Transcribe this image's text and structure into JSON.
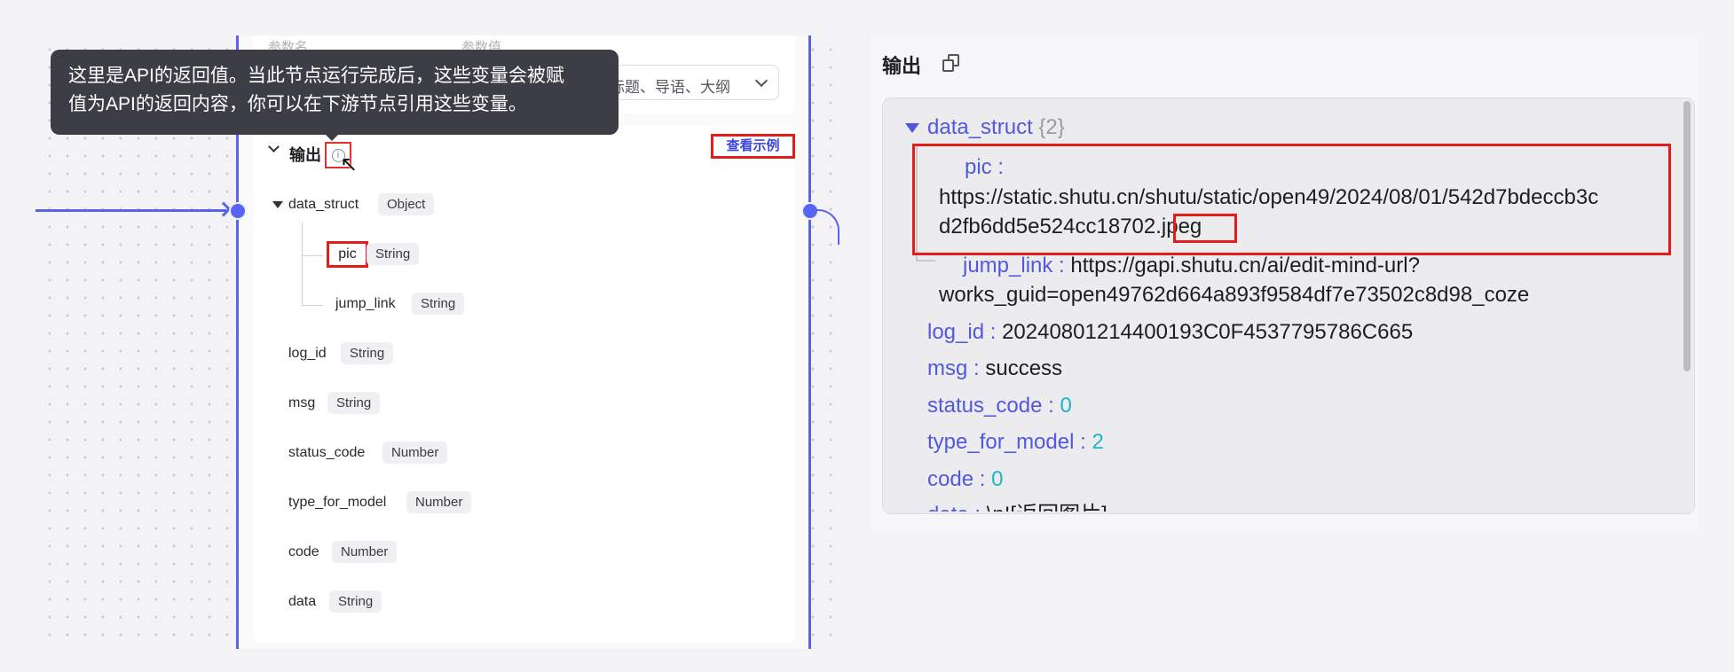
{
  "left": {
    "param_headers": {
      "name": "参数名",
      "value": "参数值"
    },
    "param_select_value": "标题、导语、大纲",
    "output_title": "输出",
    "example_link": "查看示例",
    "tooltip_line1": "这里是API的返回值。当此节点运行完成后，这些变量会被赋",
    "tooltip_line2": "值为API的返回内容，你可以在下游节点引用这些变量。",
    "fields": [
      {
        "name": "data_struct",
        "type": "Object"
      },
      {
        "name": "pic",
        "type": "String"
      },
      {
        "name": "jump_link",
        "type": "String"
      },
      {
        "name": "log_id",
        "type": "String"
      },
      {
        "name": "msg",
        "type": "String"
      },
      {
        "name": "status_code",
        "type": "Number"
      },
      {
        "name": "type_for_model",
        "type": "Number"
      },
      {
        "name": "code",
        "type": "Number"
      },
      {
        "name": "data",
        "type": "String"
      }
    ]
  },
  "right": {
    "title": "输出",
    "data_struct_key": "data_struct",
    "data_struct_count": "{2}",
    "pic_key": "pic :",
    "pic_value_line1": "https://static.shutu.cn/shutu/static/open49/2024/08/01/542d7bdeccb3c",
    "pic_value_line2": "d2fb6dd5e524cc18702.",
    "pic_value_ext": "jpeg",
    "jump_link_key": "jump_link :",
    "jump_link_value_line1": "https://gapi.shutu.cn/ai/edit-mind-url?",
    "jump_link_value_line2": "works_guid=open49762d664a893f9584df7e73502c8d98_coze",
    "log_id_key": "log_id :",
    "log_id_value": "20240801214400193C0F4537795786C665",
    "msg_key": "msg :",
    "msg_value": "success",
    "status_code_key": "status_code :",
    "status_code_value": "0",
    "type_for_model_key": "type_for_model :",
    "type_for_model_value": "2",
    "code_key": "code :",
    "code_value": "0",
    "data_key": "data :",
    "data_value": "\\n![返回图片]"
  },
  "colors": {
    "accent": "#5b63e8",
    "highlight": "#e51c1c",
    "number": "#1eb4c6"
  }
}
